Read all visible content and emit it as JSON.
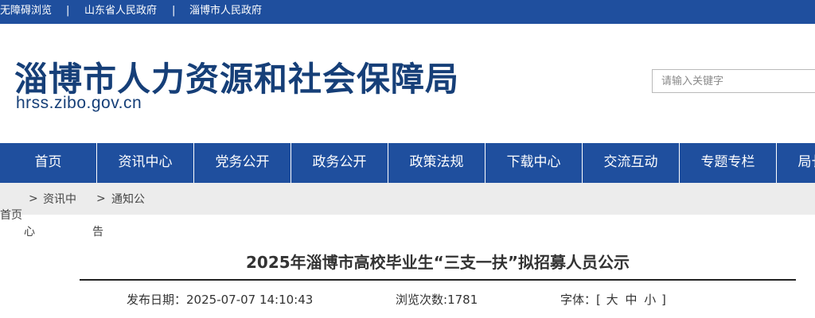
{
  "topbar": {
    "accessibility": "无障碍浏览",
    "sep": "|",
    "link_province": "山东省人民政府",
    "link_city": "淄博市人民政府"
  },
  "header": {
    "title": "淄博市人力资源和社会保障局",
    "domain": "hrss.zibo.gov.cn",
    "search_placeholder": "请输入关键字"
  },
  "nav": {
    "items": [
      "首页",
      "资讯中心",
      "党务公开",
      "政务公开",
      "政策法规",
      "下载中心",
      "交流互动",
      "专题专栏",
      "局长信箱"
    ]
  },
  "breadcrumb": {
    "home": "首页",
    "sep": ">",
    "level1_a": "资讯中",
    "level1_b": "心",
    "level2_a": "通知公",
    "level2_b": "告"
  },
  "article": {
    "title": "2025年淄博市高校毕业生“三支一扶”拟招募人员公示",
    "date_label": "发布日期：",
    "date": "2025-07-07 14:10:43",
    "views_label": "浏览次数:",
    "views": "1781",
    "font_label": "字体：",
    "bracket_open": "[",
    "font_large": "大",
    "font_medium": "中",
    "font_small": "小",
    "bracket_close": "]"
  },
  "colors": {
    "primary": "#1f4f9e",
    "title": "#163f78",
    "crumb_bg": "#ececec"
  }
}
